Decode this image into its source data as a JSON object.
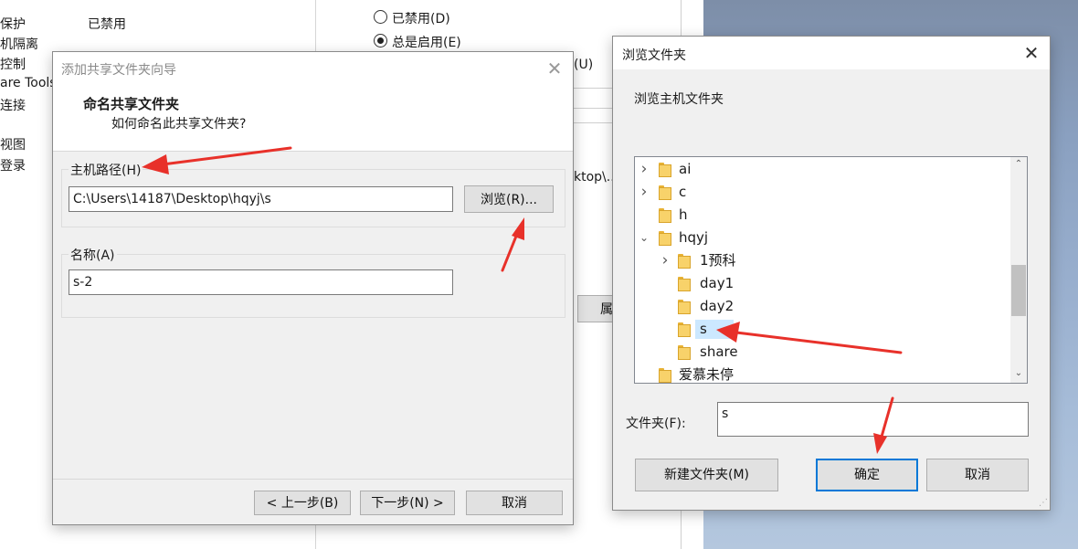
{
  "background": {
    "left_items": [
      "保护",
      "机隔离",
      "控制",
      "are Tools",
      "连接",
      "视图",
      "登录"
    ],
    "disabled_value": "已禁用",
    "radio_disabled": "已禁用(D)",
    "radio_enabled": "总是启用(E)",
    "partial_u": "(U)",
    "partial_path": "ktop\\...",
    "partial_button": "属"
  },
  "wizard": {
    "title": "添加共享文件夹向导",
    "heading": "命名共享文件夹",
    "subheading": "如何命名此共享文件夹?",
    "host_path_label": "主机路径(H)",
    "host_path_value": "C:\\Users\\14187\\Desktop\\hqyj\\s",
    "browse_button": "浏览(R)...",
    "name_label": "名称(A)",
    "name_value": "s-2",
    "back_button": "< 上一步(B)",
    "next_button": "下一步(N) >",
    "cancel_button": "取消"
  },
  "browse": {
    "title": "浏览文件夹",
    "subtitle": "浏览主机文件夹",
    "tree": [
      {
        "label": "ai",
        "level": 0,
        "expander": "collapsed",
        "selected": false
      },
      {
        "label": "c",
        "level": 0,
        "expander": "collapsed",
        "selected": false
      },
      {
        "label": "h",
        "level": 0,
        "expander": "none",
        "selected": false
      },
      {
        "label": "hqyj",
        "level": 0,
        "expander": "expanded",
        "selected": false
      },
      {
        "label": "1预科",
        "level": 1,
        "expander": "collapsed",
        "selected": false
      },
      {
        "label": "day1",
        "level": 1,
        "expander": "none",
        "selected": false
      },
      {
        "label": "day2",
        "level": 1,
        "expander": "none",
        "selected": false
      },
      {
        "label": "s",
        "level": 1,
        "expander": "none",
        "selected": true
      },
      {
        "label": "share",
        "level": 1,
        "expander": "none",
        "selected": false
      },
      {
        "label": "爱慕未停",
        "level": 0,
        "expander": "none",
        "selected": false
      }
    ],
    "folder_label": "文件夹(F):",
    "folder_value": "s",
    "new_folder_button": "新建文件夹(M)",
    "ok_button": "确定",
    "cancel_button": "取消"
  },
  "colors": {
    "annotation_arrow": "#e8312a",
    "selection": "#cce8ff",
    "accent": "#0078d7"
  }
}
